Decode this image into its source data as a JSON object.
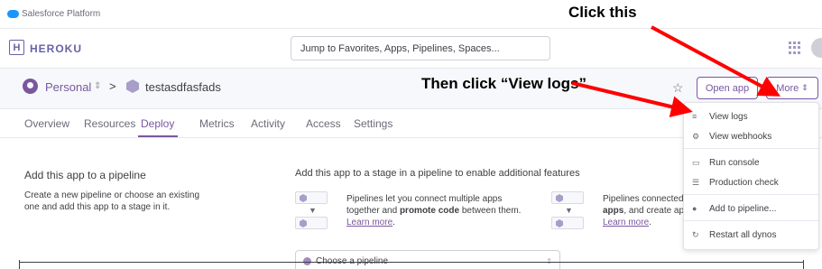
{
  "salesforce": {
    "label": "Salesforce Platform"
  },
  "header": {
    "logo_glyph": "H",
    "brand": "HEROKU",
    "search_text": "Jump to Favorites, Apps, Pipelines, Spaces..."
  },
  "app_bar": {
    "account": "Personal",
    "separator": ">",
    "app_name": "testasdfasfads",
    "open_app": "Open app",
    "more": "More"
  },
  "tabs": [
    "Overview",
    "Resources",
    "Deploy",
    "Metrics",
    "Activity",
    "Access",
    "Settings"
  ],
  "active_tab": "Deploy",
  "pipeline": {
    "title": "Add this app to a pipeline",
    "description": "Create a new pipeline or choose an existing one and add this app to a stage in it.",
    "stage_title": "Add this app to a stage in a pipeline to enable additional features",
    "feature1_pre": "Pipelines let you connect multiple apps together and ",
    "feature1_bold": "promote code",
    "feature1_post": " between them.",
    "feature1_link": "Learn more",
    "feature2_pre": "Pipelines connected",
    "feature2_bold": "apps",
    "feature2_post": ", and create app",
    "feature2_link": "Learn more",
    "choose_placeholder": "Choose a pipeline"
  },
  "dropdown": {
    "items": [
      "View logs",
      "View webhooks",
      "Run console",
      "Production check",
      "Add to pipeline...",
      "Restart all dynos"
    ]
  },
  "annotations": {
    "click_this": "Click this",
    "then_click": "Then click “View logs”"
  },
  "colors": {
    "brand": "#79589f",
    "annotation_arrow": "#ff0000"
  }
}
